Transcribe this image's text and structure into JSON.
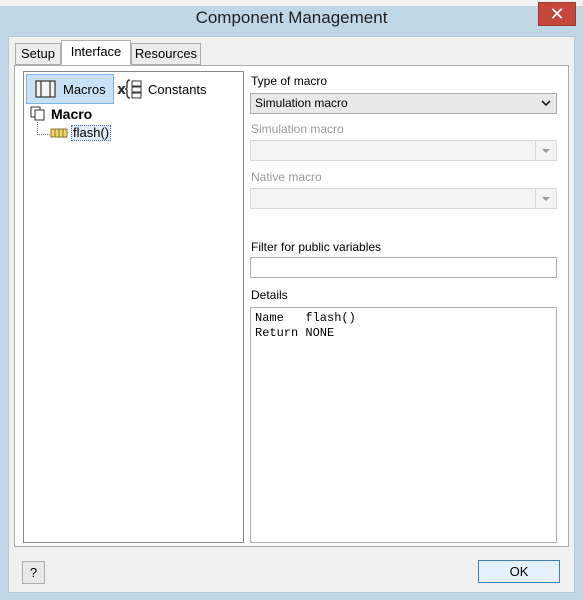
{
  "window": {
    "title": "Component Management",
    "close_glyph": "✕"
  },
  "tabs": [
    {
      "label": "Setup"
    },
    {
      "label": "Interface",
      "active": true
    },
    {
      "label": "Resources"
    }
  ],
  "left": {
    "toolbar": {
      "macros_label": "Macros",
      "constants_label": "Constants"
    },
    "tree": {
      "root_label": "Macro",
      "child_label": "flash()"
    }
  },
  "right": {
    "type_of_macro": {
      "label": "Type of macro",
      "value": "Simulation macro"
    },
    "simulation_macro": {
      "label": "Simulation macro",
      "value": ""
    },
    "native_macro": {
      "label": "Native macro",
      "value": ""
    },
    "filter": {
      "label": "Filter for public variables",
      "value": ""
    },
    "details": {
      "label": "Details",
      "text": "Name   flash()\nReturn NONE"
    }
  },
  "footer": {
    "help_label": "?",
    "ok_label": "OK"
  },
  "colors": {
    "title_bar": "#c0d7e8",
    "close": "#c7463c",
    "selection": "#c8e1f7"
  },
  "icons": [
    "close-icon",
    "macros-icon",
    "constants-icon",
    "tree-root-icon",
    "macro-item-icon",
    "chevron-down-icon"
  ]
}
